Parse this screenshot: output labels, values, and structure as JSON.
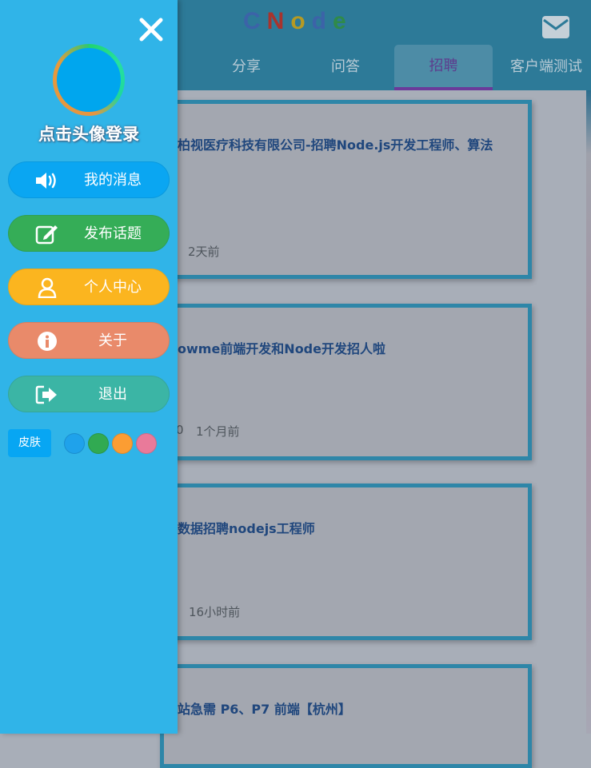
{
  "header": {
    "logo_letters": [
      "C",
      "N",
      "o",
      "d",
      "e"
    ],
    "mail_icon": "envelope-icon",
    "tabs": [
      {
        "label": "分享",
        "active": false
      },
      {
        "label": "问答",
        "active": false
      },
      {
        "label": "招聘",
        "active": true
      },
      {
        "label": "客户端测试",
        "active": false
      }
    ]
  },
  "topics": [
    {
      "title": "柏视医疗科技有限公司-招聘Node.js开发工程师、算法",
      "time": "2天前"
    },
    {
      "title": "owme前端开发和Node开发招人啦",
      "time": "1个月前",
      "count_fragment": "0"
    },
    {
      "title": "数据招聘nodejs工程师",
      "time": "16小时前"
    },
    {
      "title": "站急需 P6、P7 前端【杭州】",
      "time": ""
    }
  ],
  "drawer": {
    "close_icon": "close-icon",
    "login_text": "点击头像登录",
    "menu": [
      {
        "label": "我的消息",
        "icon": "volume-icon",
        "color": "#0aa6f2"
      },
      {
        "label": "发布话题",
        "icon": "edit-icon",
        "color": "#35ad57"
      },
      {
        "label": "个人中心",
        "icon": "user-icon",
        "color": "#fbb51f"
      },
      {
        "label": "关于",
        "icon": "info-icon",
        "color": "#e98a6a"
      },
      {
        "label": "退出",
        "icon": "sign-out-icon",
        "color": "#3bb5a5"
      }
    ],
    "skin_label": "皮肤",
    "skin_colors": [
      "#1fa2eb",
      "#31aa52",
      "#fb9d33",
      "#e97a9a"
    ]
  }
}
